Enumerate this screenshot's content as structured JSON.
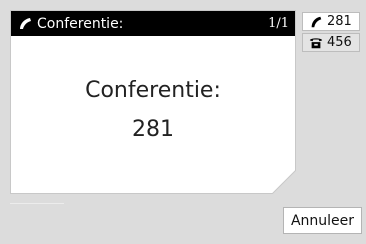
{
  "call_panel": {
    "header_title": "Conferentie:",
    "header_count": "1/1",
    "main_title": "Conferentie:",
    "main_number": "281"
  },
  "lines": [
    {
      "number": "281",
      "icon": "handset-icon",
      "active": true
    },
    {
      "number": "456",
      "icon": "desk-phone-icon",
      "active": false
    }
  ],
  "softkeys": {
    "cancel_label": "Annuleer"
  }
}
